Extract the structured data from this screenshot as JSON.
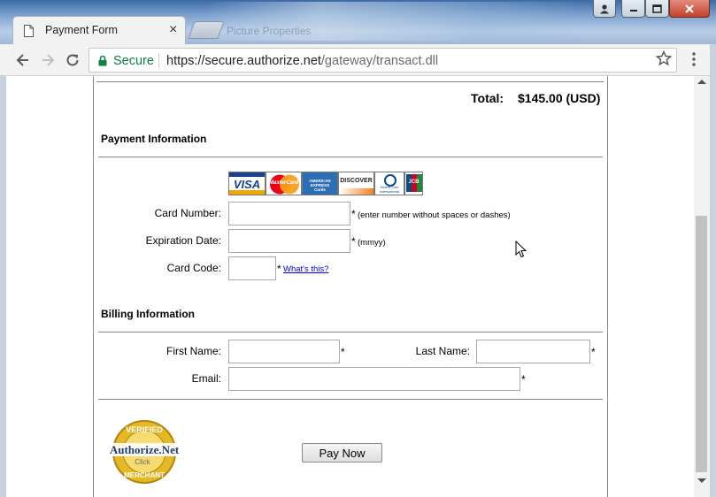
{
  "browser": {
    "tab_title": "Payment Form",
    "ghost_tab_title": "Picture Properties",
    "secure_label": "Secure",
    "url_host": "https://secure.authorize.net",
    "url_path": "/gateway/transact.dll"
  },
  "order": {
    "total_label": "Total:",
    "total_value": "$145.00 (USD)"
  },
  "payment": {
    "section_title": "Payment Information",
    "card_brands": [
      "VISA",
      "MasterCard",
      "AMERICAN EXPRESS Cards",
      "DISCOVER",
      "Diners Club International",
      "JCB"
    ],
    "card_number_label": "Card Number:",
    "card_number_hint": "(enter number without spaces or dashes)",
    "expiration_label": "Expiration Date:",
    "expiration_hint": "(mmyy)",
    "card_code_label": "Card Code:",
    "whats_this": "What's this?",
    "required_mark": "*"
  },
  "billing": {
    "section_title": "Billing Information",
    "first_name_label": "First Name:",
    "last_name_label": "Last Name:",
    "email_label": "Email:",
    "required_mark": "*"
  },
  "actions": {
    "pay_now": "Pay Now"
  },
  "seal": {
    "top_text": "VERIFIED",
    "brand": "Authorize.Net",
    "click": "Click",
    "bottom_text": "MERCHANT"
  },
  "colors": {
    "secure_green": "#0b8043",
    "link_blue": "#0000ee",
    "seal_gold": "#d4a514"
  }
}
